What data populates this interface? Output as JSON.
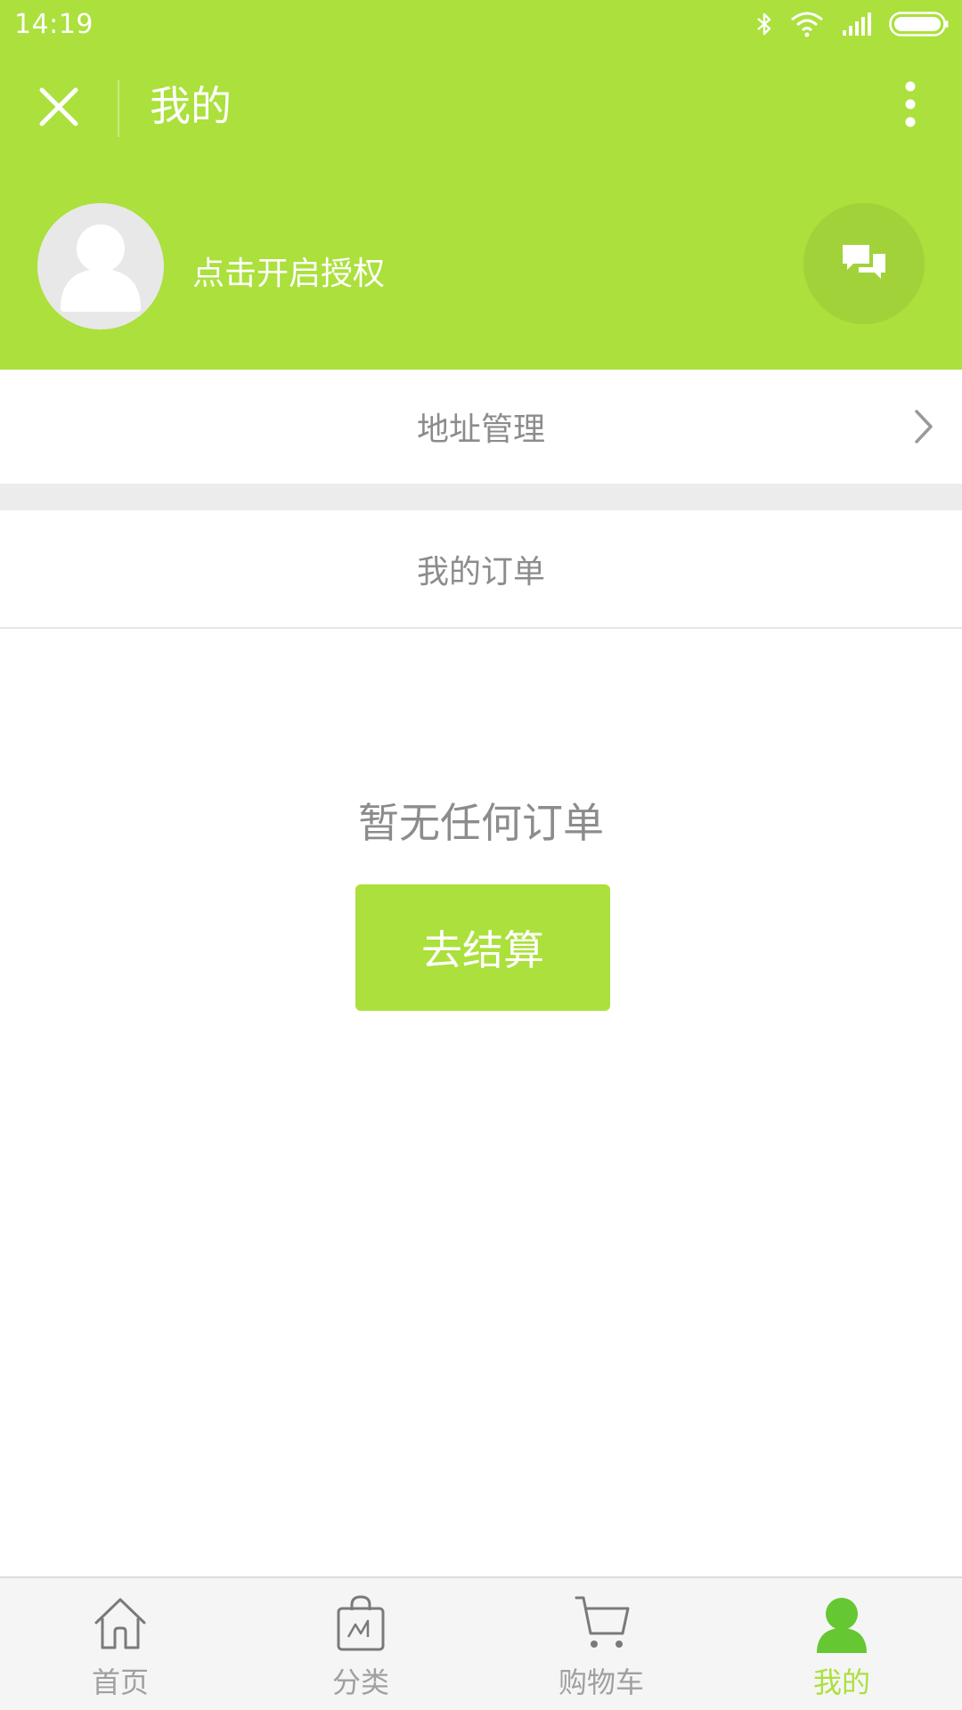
{
  "status": {
    "time": "14:19"
  },
  "nav": {
    "title": "我的"
  },
  "profile": {
    "auth_text": "点击开启授权"
  },
  "menu": {
    "address": "地址管理",
    "orders": "我的订单"
  },
  "empty": {
    "text": "暂无任何订单",
    "button": "去结算"
  },
  "tabs": [
    {
      "label": "首页",
      "icon": "home-icon"
    },
    {
      "label": "分类",
      "icon": "shopping-bag-icon"
    },
    {
      "label": "购物车",
      "icon": "cart-icon"
    },
    {
      "label": "我的",
      "icon": "user-icon",
      "active": true
    }
  ],
  "colors": {
    "accent": "#abe03d",
    "text_muted": "#8c8c8c",
    "tab_inactive": "#a0a0a0"
  }
}
